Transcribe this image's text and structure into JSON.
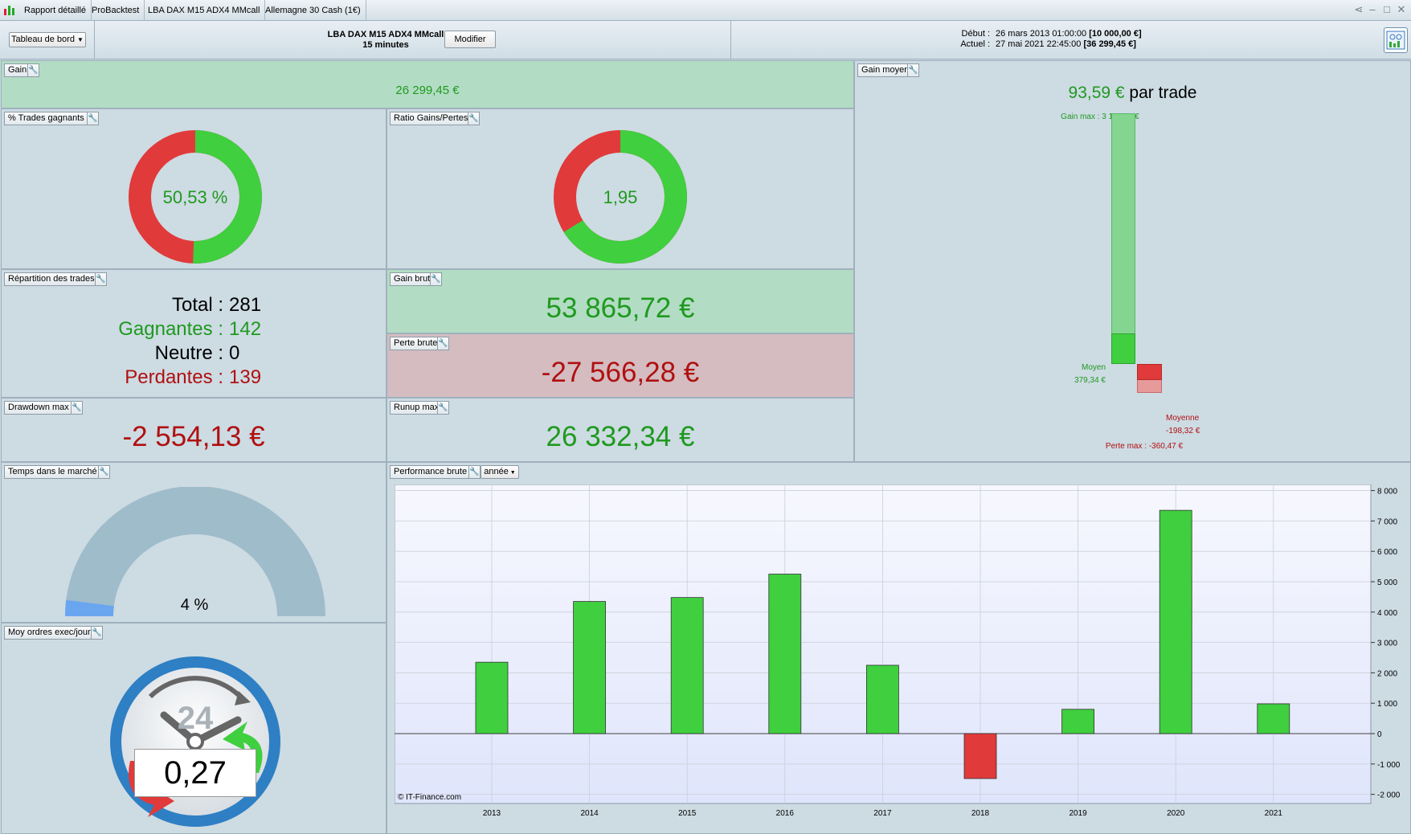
{
  "titlebar": {
    "tabs": [
      "Rapport détaillé",
      "ProBacktest",
      "LBA DAX M15 ADX4 MMcall",
      "Allemagne 30 Cash (1€)"
    ],
    "icons": [
      "share-icon",
      "minimize-icon",
      "maximize-icon",
      "close-icon"
    ]
  },
  "header": {
    "dropdown_label": "Tableau de bord",
    "strategy_name": "LBA DAX M15 ADX4 MMcall",
    "timeframe": "15 minutes",
    "modify_label": "Modifier",
    "start_label": "Début :",
    "start_date": "26 mars 2013 01:00:00",
    "start_capital": "[10 000,00 €]",
    "current_label": "Actuel :",
    "current_date": "27 mai 2021 22:45:00",
    "current_capital": "[36 299,45 €]"
  },
  "gain": {
    "title": "Gain",
    "value": "26 299,45 €"
  },
  "win_trades": {
    "title": "% Trades gagnants",
    "value": "50,53 %",
    "pct": 50.53
  },
  "ratio": {
    "title": "Ratio Gains/Pertes",
    "value": "1,95",
    "pct": 66.1
  },
  "distribution": {
    "title": "Répartition des trades",
    "total_label": "Total : ",
    "total": "281",
    "win_label": "Gagnantes : ",
    "win": "142",
    "neutral_label": "Neutre : ",
    "neutral": "0",
    "loss_label": "Perdantes : ",
    "loss": "139"
  },
  "gross_gain": {
    "title": "Gain brut",
    "value": "53 865,72 €"
  },
  "gross_loss": {
    "title": "Perte brute",
    "value": "-27 566,28 €"
  },
  "drawdown": {
    "title": "Drawdown max",
    "value": "-2 554,13 €"
  },
  "runup": {
    "title": "Runup max",
    "value": "26 332,34 €"
  },
  "avg_gain": {
    "title": "Gain moyen",
    "value": "93,59 €",
    "suffix": " par trade",
    "max_gain_label": "Gain max : 3 119,94 €",
    "avg_win_label": "Moyen",
    "avg_win_value": "379,34 €",
    "avg_loss_label": "Moyenne",
    "avg_loss_value": "-198,32 €",
    "max_loss_label": "Perte max : -360,47 €",
    "max_gain": 3119.94,
    "avg_win": 379.34,
    "avg_loss": -198.32,
    "max_loss": -360.47
  },
  "time_in_market": {
    "title": "Temps dans le marché",
    "value": "4 %",
    "pct": 4
  },
  "orders_per_day": {
    "title": "Moy ordres exec/jour",
    "dial_label": "24",
    "value": "0,27"
  },
  "performance": {
    "title": "Performance brute",
    "period": "année",
    "copyright": "© IT-Finance.com"
  },
  "colors": {
    "green": "#3fcf3f",
    "red": "#e03a3a",
    "panel": "#cddbe3",
    "green_panel": "#b2dcc4",
    "red_panel": "#d4bcc1"
  },
  "chart_data": {
    "type": "bar",
    "categories": [
      "2013",
      "2014",
      "2015",
      "2016",
      "2017",
      "2018",
      "2019",
      "2020",
      "2021"
    ],
    "values": [
      2350,
      4350,
      4480,
      5250,
      2250,
      -1480,
      800,
      7350,
      980
    ],
    "ylim": [
      -2300,
      8200
    ],
    "yticks": [
      8000,
      7000,
      6000,
      5000,
      4000,
      3000,
      2000,
      1000,
      0,
      -1000,
      -2000
    ],
    "ytick_labels": [
      "8 000",
      "7 000",
      "6 000",
      "5 000",
      "4 000",
      "3 000",
      "2 000",
      "1 000",
      "0",
      "-1 000",
      "-2 000"
    ],
    "grid": true
  }
}
